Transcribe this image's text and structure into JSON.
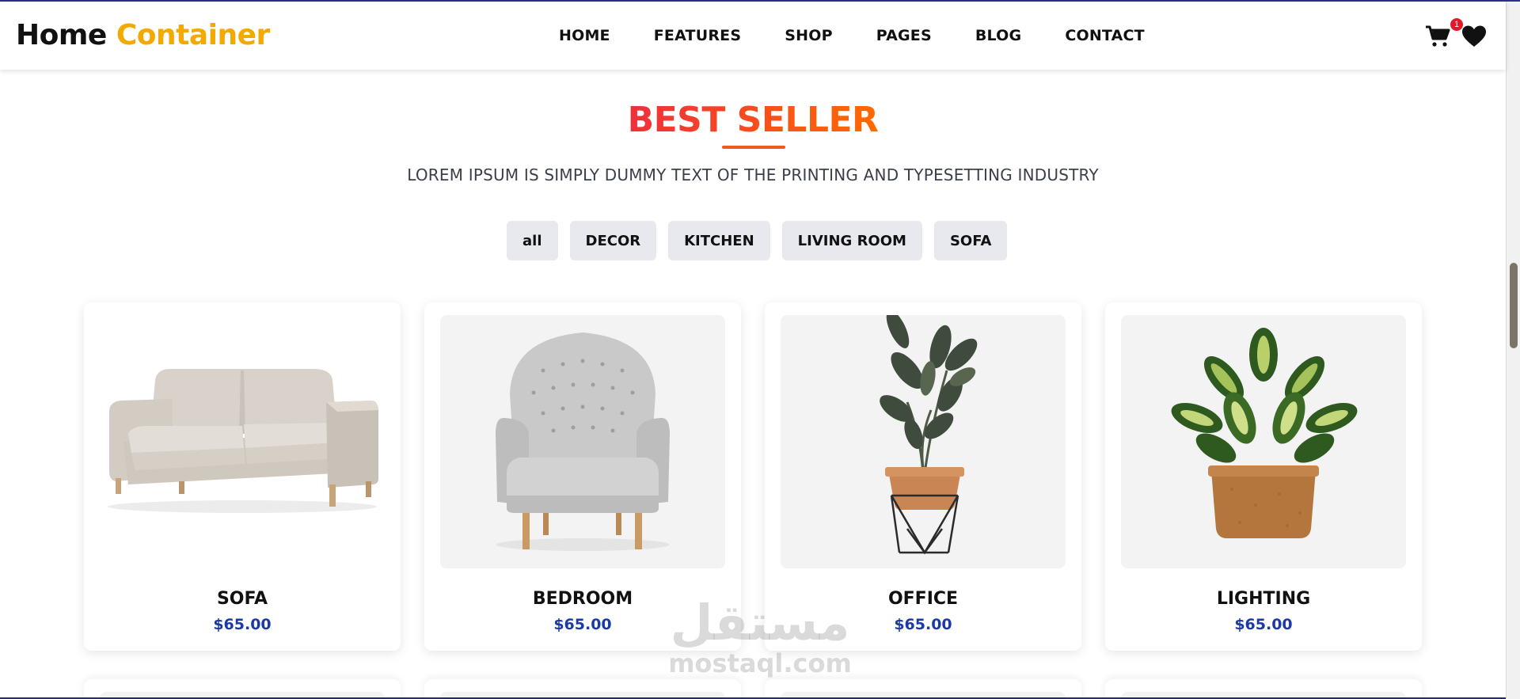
{
  "brand": {
    "part1": "Home",
    "part2": "Container"
  },
  "nav": {
    "links": [
      "HOME",
      "FEATURES",
      "SHOP",
      "PAGES",
      "BLOG",
      "CONTACT"
    ],
    "cart_count": "1"
  },
  "section": {
    "title": "BEST SELLER",
    "subtitle": "LOREM IPSUM IS SIMPLY DUMMY TEXT OF THE PRINTING AND TYPESETTING INDUSTRY"
  },
  "filters": [
    "all",
    "DECOR",
    "KITCHEN",
    "LIVING ROOM",
    "SOFA"
  ],
  "products": [
    {
      "name": "SOFA",
      "price": "$65.00",
      "image": "sofa-image"
    },
    {
      "name": "BEDROOM",
      "price": "$65.00",
      "image": "armchair-image"
    },
    {
      "name": "OFFICE",
      "price": "$65.00",
      "image": "potted-plant-image"
    },
    {
      "name": "LIGHTING",
      "price": "$65.00",
      "image": "potted-plant-image"
    }
  ],
  "watermark": {
    "arabic": "مستقل",
    "latin": "mostaql.com"
  },
  "colors": {
    "accent_yellow": "#f2a900",
    "title_gradient_start": "#ef2f3c",
    "title_gradient_end": "#ff6a00",
    "price_blue": "#1b3aa8",
    "badge_red": "#e4182b"
  }
}
